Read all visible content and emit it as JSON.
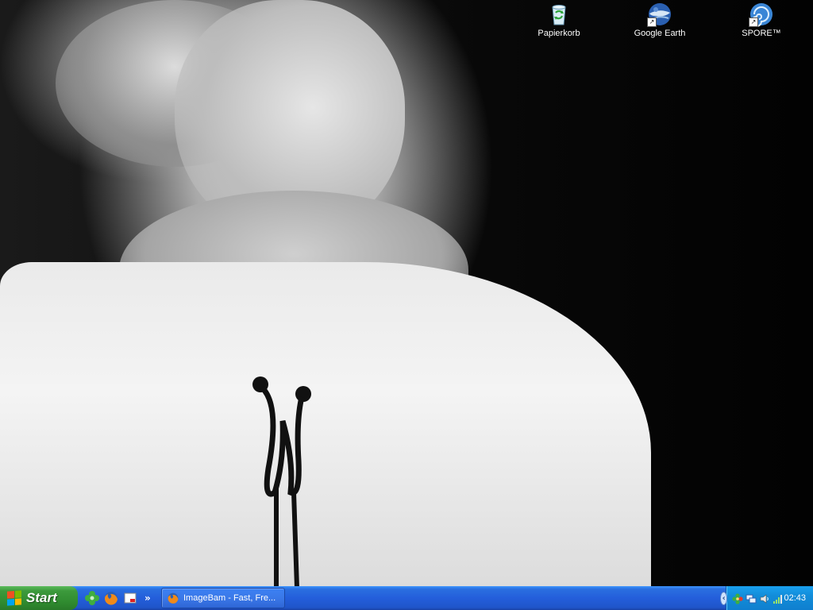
{
  "desktop": {
    "icons": [
      {
        "label": "Papierkorb",
        "icon": "recycle-bin-icon"
      },
      {
        "label": "Google Earth",
        "icon": "google-earth-icon",
        "shortcut": true
      },
      {
        "label": "SPORE™",
        "icon": "spore-icon",
        "shortcut": true
      }
    ]
  },
  "taskbar": {
    "start_label": "Start",
    "quicklaunch": [
      "clover-icon",
      "firefox-icon",
      "show-desktop-icon"
    ],
    "quicklaunch_more": "»",
    "tasks": [
      {
        "label": "ImageBam - Fast, Fre...",
        "icon": "firefox-icon"
      }
    ],
    "tray": {
      "expand": "‹",
      "icons": [
        "icq-flower-icon",
        "network-icon",
        "speaker-icon",
        "signal-bars-icon"
      ],
      "clock": "02:43"
    }
  },
  "colors": {
    "taskbar_blue": "#245edb",
    "start_green": "#3c9a3c",
    "tray_blue": "#128dd9"
  }
}
